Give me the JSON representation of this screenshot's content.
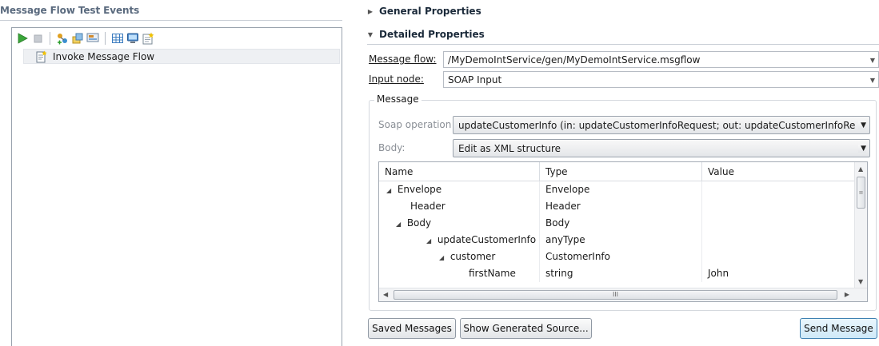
{
  "left_panel": {
    "title": "Message Flow Test Events",
    "toolbar_icons": [
      "run-icon",
      "stop-icon",
      "new-flow-icon",
      "edit-icon",
      "monitor-icon",
      "table-icon",
      "display-icon",
      "new-event-icon"
    ],
    "tree_item": {
      "label": "Invoke Message Flow",
      "icon": "invoke-event-icon"
    }
  },
  "sections": {
    "general": "General Properties",
    "detailed": "Detailed Properties"
  },
  "form": {
    "message_flow_label": "Message flow:",
    "message_flow_value": "/MyDemoIntService/gen/MyDemoIntService.msgflow",
    "input_node_label": "Input node:",
    "input_node_value": "SOAP Input"
  },
  "message_group": {
    "legend": "Message",
    "soap_operation_label": "Soap operation",
    "soap_operation_value": "updateCustomerInfo (in: updateCustomerInfoRequest; out: updateCustomerInfoRe",
    "body_label": "Body:",
    "body_value": "Edit as XML structure"
  },
  "table": {
    "columns": [
      "Name",
      "Type",
      "Value"
    ],
    "rows": [
      {
        "name": "Envelope",
        "type": "Envelope",
        "value": "",
        "expanded": true
      },
      {
        "name": "Header",
        "type": "Header",
        "value": "",
        "expanded": false
      },
      {
        "name": "Body",
        "type": "Body",
        "value": "",
        "expanded": true
      },
      {
        "name": "updateCustomerInfo",
        "type": "anyType",
        "value": "",
        "expanded": true
      },
      {
        "name": "customer",
        "type": "CustomerInfo",
        "value": "",
        "expanded": true
      },
      {
        "name": "firstName",
        "type": "string",
        "value": "John",
        "expanded": false
      }
    ],
    "hscroll_grip": "III"
  },
  "buttons": {
    "saved_messages": "Saved Messages",
    "show_generated_source": "Show Generated Source...",
    "send_message": "Send Message"
  }
}
